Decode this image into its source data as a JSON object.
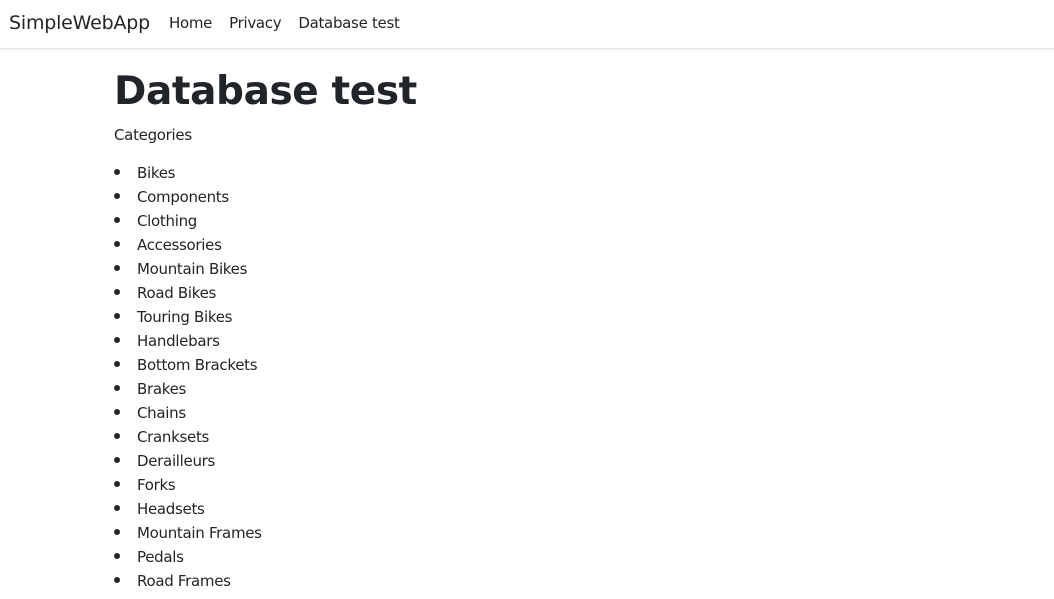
{
  "navbar": {
    "brand": "SimpleWebApp",
    "links": [
      "Home",
      "Privacy",
      "Database test"
    ]
  },
  "main": {
    "title": "Database test",
    "subtitle": "Categories",
    "categories": [
      "Bikes",
      "Components",
      "Clothing",
      "Accessories",
      "Mountain Bikes",
      "Road Bikes",
      "Touring Bikes",
      "Handlebars",
      "Bottom Brackets",
      "Brakes",
      "Chains",
      "Cranksets",
      "Derailleurs",
      "Forks",
      "Headsets",
      "Mountain Frames",
      "Pedals",
      "Road Frames"
    ]
  },
  "colors": {
    "text": "#212529",
    "background": "#ffffff",
    "navbar_border": "#e3e3e3"
  }
}
